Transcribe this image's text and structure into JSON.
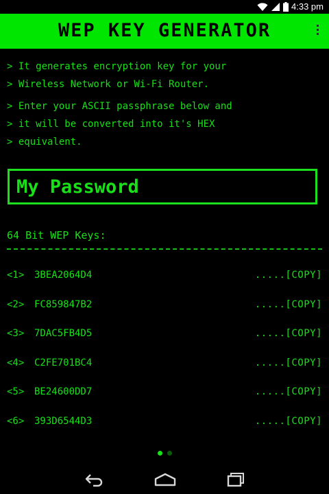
{
  "status_bar": {
    "time": "4:33 pm"
  },
  "app_bar": {
    "title": "WEP KEY GENERATOR"
  },
  "description_lines": [
    "> It generates encryption key for your",
    "> Wireless Network or Wi-Fi Router.",
    "> Enter your ASCII passphrase below and",
    "> it will be converted into it's HEX",
    "> equivalent."
  ],
  "passphrase": {
    "value": "My Password"
  },
  "keys_section": {
    "title": "64 Bit WEP Keys:",
    "copy_label": ".....[COPY]",
    "keys": [
      {
        "index": "<1>",
        "value": "3BEA2064D4"
      },
      {
        "index": "<2>",
        "value": "FC859847B2"
      },
      {
        "index": "<3>",
        "value": "7DAC5FB4D5"
      },
      {
        "index": "<4>",
        "value": "C2FE701BC4"
      },
      {
        "index": "<5>",
        "value": "BE24600DD7"
      },
      {
        "index": "<6>",
        "value": "393D6544D3"
      }
    ]
  },
  "pager": {
    "count": 2,
    "active": 1
  },
  "colors": {
    "accent": "#00e600",
    "text": "#19e019",
    "background": "#000000",
    "dot_active": "#19e019",
    "dot_inactive": "#0a5a0a"
  },
  "icons": {
    "status": [
      "wifi-icon",
      "signal-icon",
      "battery-icon"
    ],
    "nav": [
      "back-icon",
      "home-icon",
      "recents-icon"
    ],
    "menu": "overflow-menu-icon"
  }
}
